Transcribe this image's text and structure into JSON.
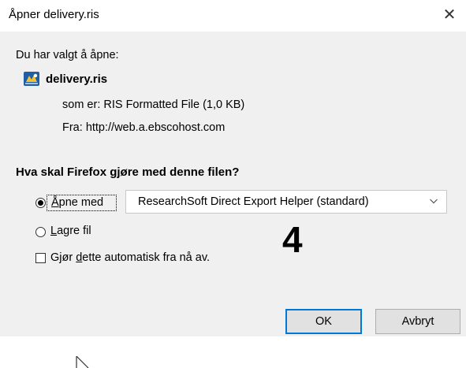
{
  "window": {
    "title": "Åpner delivery.ris",
    "close_glyph": "✕"
  },
  "dialog": {
    "intro": "Du har valgt å åpne:",
    "file_icon": "ris-file-icon",
    "filename": "delivery.ris",
    "type_label": "som er:",
    "type_value": "RIS Formatted File (1,0 KB)",
    "from_label": "Fra:",
    "from_value": "http://web.a.ebscohost.com",
    "question": "Hva skal Firefox gjøre med denne filen?",
    "open_with": {
      "access_key": "Å",
      "rest": "pne med",
      "selected": true
    },
    "app_select": {
      "value": "ResearchSoft Direct Export Helper (standard)"
    },
    "save_file": {
      "access_key": "L",
      "rest": "agre fil",
      "selected": false
    },
    "auto_checkbox": {
      "before": "Gjør ",
      "access_key": "d",
      "after": "ette automatisk fra nå av.",
      "checked": false
    },
    "annotation_number": "4",
    "ok_label": "OK",
    "cancel_label": "Avbryt"
  },
  "colors": {
    "dialog_bg": "#f0f0f0",
    "button_bg": "#e1e1e1",
    "default_button_border": "#0078d7"
  }
}
